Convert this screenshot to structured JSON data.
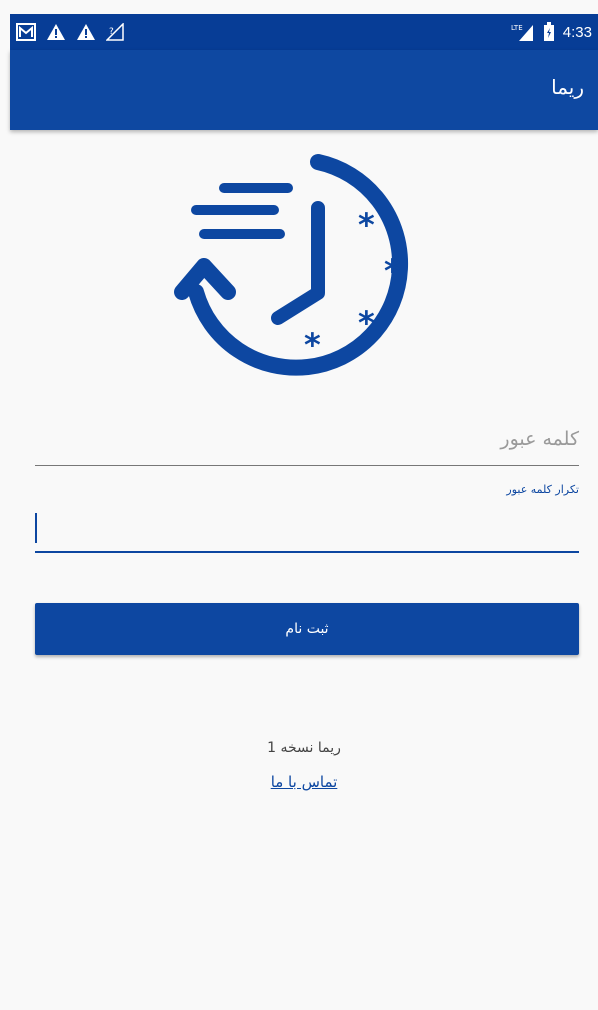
{
  "status_bar": {
    "time": "4:33",
    "left_icons": [
      "gmail-icon",
      "warning-icon",
      "warning-icon",
      "no-signal-icon"
    ],
    "right_icons": [
      "lte-signal-icon",
      "battery-icon"
    ]
  },
  "app_bar": {
    "title": "ریما"
  },
  "logo": {
    "icon": "timer-clock-logo"
  },
  "form": {
    "password_placeholder": "کلمه عبور",
    "repeat_password_label": "تکرار کلمه عبور",
    "repeat_password_value": ""
  },
  "submit_label": "ثبت نام",
  "footer": {
    "version": "ریما نسخه 1",
    "contact_link": "تماس با ما"
  },
  "colors": {
    "status_bar": "#073d96",
    "primary": "#0e48a1",
    "background": "#f9f9f9"
  }
}
